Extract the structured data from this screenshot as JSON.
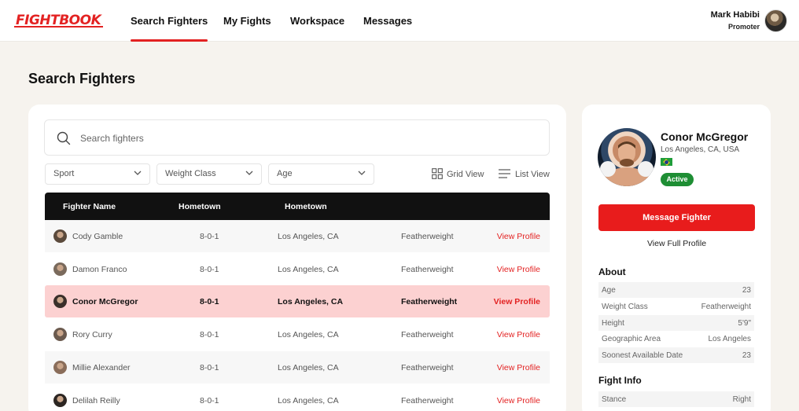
{
  "header": {
    "logo": "FIGHTBOOK",
    "nav": [
      {
        "label": "Search Fighters",
        "active": true
      },
      {
        "label": "My Fights",
        "active": false
      },
      {
        "label": "Workspace",
        "active": false
      },
      {
        "label": "Messages",
        "active": false
      }
    ],
    "user": {
      "name": "Mark Habibi",
      "role": "Promoter"
    }
  },
  "page_title": "Search Fighters",
  "search": {
    "placeholder": "Search fighters",
    "value": ""
  },
  "filters": {
    "sport": "Sport",
    "weight_class": "Weight Class",
    "age": "Age"
  },
  "views": {
    "grid": "Grid View",
    "list": "List View"
  },
  "table": {
    "headers": [
      "Fighter Name",
      "Hometown",
      "Hometown"
    ],
    "rows": [
      {
        "name": "Cody Gamble",
        "record": "8-0-1",
        "hometown": "Los Angeles, CA",
        "weight": "Featherweight",
        "action": "View Profile"
      },
      {
        "name": "Damon Franco",
        "record": "8-0-1",
        "hometown": "Los Angeles, CA",
        "weight": "Featherweight",
        "action": "View Profile"
      },
      {
        "name": "Conor McGregor",
        "record": "8-0-1",
        "hometown": "Los Angeles, CA",
        "weight": "Featherweight",
        "action": "View Profile",
        "selected": true
      },
      {
        "name": "Rory Curry",
        "record": "8-0-1",
        "hometown": "Los Angeles, CA",
        "weight": "Featherweight",
        "action": "View Profile"
      },
      {
        "name": "Millie Alexander",
        "record": "8-0-1",
        "hometown": "Los Angeles, CA",
        "weight": "Featherweight",
        "action": "View Profile"
      },
      {
        "name": "Delilah Reilly",
        "record": "8-0-1",
        "hometown": "Los Angeles, CA",
        "weight": "Featherweight",
        "action": "View Profile"
      }
    ]
  },
  "profile": {
    "name": "Conor McGregor",
    "location": "Los Angeles, CA, USA",
    "status": "Active",
    "message_button": "Message Fighter",
    "full_profile": "View Full Profile",
    "about_title": "About",
    "about": [
      {
        "label": "Age",
        "value": "23"
      },
      {
        "label": "Weight Class",
        "value": "Featherweight"
      },
      {
        "label": "Height",
        "value": "5'9\""
      },
      {
        "label": "Geographic Area",
        "value": "Los Angeles"
      },
      {
        "label": "Soonest Available Date",
        "value": "23"
      }
    ],
    "fight_info_title": "Fight Info",
    "fight_info": [
      {
        "label": "Stance",
        "value": "Right"
      }
    ]
  },
  "colors": {
    "accent": "#e32222",
    "selected_row": "#fcd1d1",
    "active_badge": "#1e8e34"
  }
}
